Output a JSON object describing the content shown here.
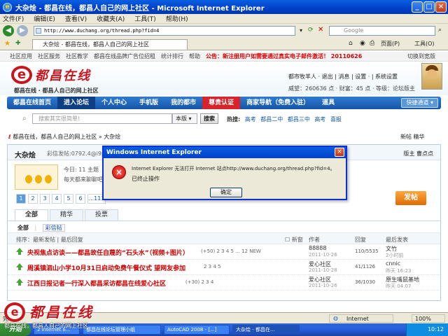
{
  "window": {
    "title": "大杂烩 - 都昌在线，都昌人自己的网上社区 - Microsoft Internet Explorer",
    "min": "_",
    "max": "□",
    "close": "×"
  },
  "menu": [
    "文件(F)",
    "编辑(E)",
    "查看(V)",
    "收藏夹(A)",
    "工具(T)",
    "帮助(H)"
  ],
  "address": {
    "url": "http://www.duchang.org/thread.php?fid=4",
    "search_placeholder": "Google"
  },
  "tabs": {
    "active": "大杂烩 - 都昌在线，都昌人自己的网上社区",
    "home_label": "页面(P)",
    "tools_label": "工具(O)"
  },
  "site_links": {
    "items": [
      "社区应用",
      "社区服务",
      "社区教学",
      "都昌在线品牌广告位招租",
      "统计排行",
      "帮助"
    ],
    "notice": "公告：新注册用户如需要通过真实电子邮件激活！ 20110626",
    "skin": "切换到宽版"
  },
  "header": {
    "logo_mark": "e",
    "logo_text": "都昌在线",
    "slogan": "都昌在线 · 都昌人自己的网上社区",
    "user_line1": "都市牧羊人 ·  退出 | 消息 | 设置 · | 系统设置",
    "user_line2": "威望：260636 点 · 财富：45 点 · 等级：论坛版主"
  },
  "nav": {
    "items": [
      "都昌在线首页",
      "进入论坛",
      "个人中心",
      "手机版",
      "我的都市",
      "尊贵认证",
      "商家导航（免费入驻）",
      "道具"
    ],
    "quick": "快捷通道 ▾"
  },
  "search": {
    "placeholder": "搜索其实很简单!",
    "scope": "本版 ▾",
    "button": "搜索",
    "hot_label": "热搜:",
    "hot_items": [
      "高考",
      "都昌二中",
      "都昌三中",
      "高考",
      "喜报"
    ]
  },
  "breadcrumb": {
    "path": "都昌在线，都昌人自己的网上社区 » 大杂烩",
    "right": "新帖   精华"
  },
  "forum": {
    "name": "大杂烩",
    "meta": "彩信发帖:0792.4@i9p",
    "mods": "版主  曹点点",
    "today": "今日: 11   主题",
    "desc": "每天都来聊聊吧"
  },
  "pager": [
    "1",
    "2",
    "3",
    "4",
    "5",
    "6",
    "...113"
  ],
  "post_button": "发帖",
  "list_tabs": [
    "全部",
    "精华",
    "投票"
  ],
  "subtabs": {
    "current": "全部",
    "other": "彩信帖"
  },
  "sort_row": {
    "left": "排序：最新发帖 | 最后回复",
    "new_label": "新窗",
    "author": "作者",
    "replies": "回复",
    "last": "最后发表"
  },
  "threads": [
    {
      "title": "央视焦点访谈——都昌故任自蔑的“石头水”（视频+图片）",
      "extra": "(+50)  2 3 4 5 ... 12  NEW",
      "author": "88888",
      "date": "2011-10-26",
      "rv": "110/5535",
      "last": "文竹",
      "last_date": "2小时前"
    },
    {
      "title": "周溪镇泗山小学10月31日启动免费午餐仪式 望网友参加",
      "extra": "2 3 4 5",
      "author": "爱心社区",
      "date": "2011-10-28",
      "rv": "41/1126",
      "last": "cnnic",
      "last_date": "昨天 16:23"
    },
    {
      "title": "江西日报记者一行深入都昌采访都昌在线爱心社区",
      "extra": "(+30)  2 3 4",
      "author": "爱心社区",
      "date": "2011-10-26",
      "rv": "36/1030",
      "last": "原生嘴鼠基地",
      "last_date": "昨天 04:07"
    }
  ],
  "dialog": {
    "title": "Windows Internet Explorer",
    "message": "Internet Explorer 无法打开 Internet 站点http://www.duchang.org/thread.php?fid=4。",
    "message2": "已终止操作",
    "ok": "确定",
    "icon": "×"
  },
  "status": {
    "left": "完",
    "zone": "Internet",
    "zoom": "100%"
  },
  "taskbar": {
    "start": "开始",
    "items": [
      "2 Internet E...",
      "都昌在线论坛管理小组",
      "AutoCAD 2008 - [...]",
      "大杂烩 - 都昌在..."
    ],
    "clock": "10:12"
  },
  "watermark": {
    "mark": "e",
    "text": "都昌在线",
    "sub": "都昌在线，都昌人自己的网上社区"
  }
}
